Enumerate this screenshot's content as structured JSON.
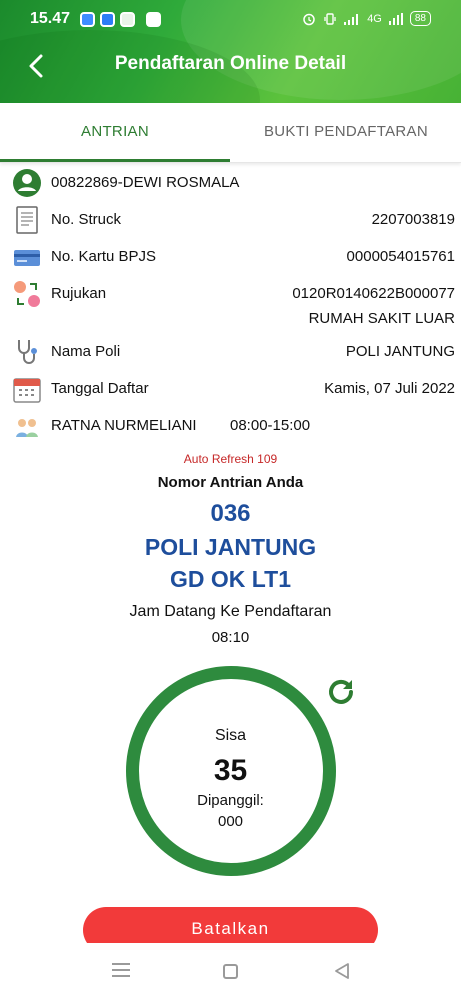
{
  "status_bar": {
    "time": "15.47",
    "network": "4G",
    "battery": "88"
  },
  "header": {
    "title": "Pendaftaran Online Detail"
  },
  "tabs": [
    {
      "label": "ANTRIAN",
      "active": true
    },
    {
      "label": "BUKTI PENDAFTARAN",
      "active": false
    }
  ],
  "patient": {
    "name": "00822869-DEWI ROSMALA"
  },
  "struck": {
    "label": "No. Struck",
    "value": "2207003819"
  },
  "bpjs": {
    "label": "No. Kartu BPJS",
    "value": "0000054015761"
  },
  "rujukan": {
    "label": "Rujukan",
    "value": "0120R0140622B000077",
    "sub": "RUMAH SAKIT LUAR"
  },
  "poli": {
    "label": "Nama Poli",
    "value": "POLI JANTUNG"
  },
  "tanggal": {
    "label": "Tanggal Daftar",
    "value": "Kamis, 07 Juli 2022"
  },
  "doctor": {
    "name": "RATNA NURMELIANI",
    "hours": "08:00-15:00"
  },
  "queue": {
    "auto_refresh": "Auto Refresh 109",
    "label": "Nomor Antrian Anda",
    "number": "036",
    "poli": "POLI JANTUNG",
    "location": "GD OK LT1",
    "jam_label": "Jam Datang Ke Pendaftaran",
    "jam_value": "08:10",
    "sisa_label": "Sisa",
    "sisa_value": "35",
    "dipanggil_label": "Dipanggil:",
    "dipanggil_value": "000"
  },
  "actions": {
    "cancel_label": "Batalkan"
  },
  "colors": {
    "primary_green": "#2e7d32",
    "queue_blue": "#1e4e9c",
    "cancel_red": "#f23a3a",
    "refresh_red": "#c62828"
  },
  "icons": [
    "back-arrow-icon",
    "user-icon",
    "receipt-icon",
    "card-icon",
    "referral-icon",
    "stethoscope-icon",
    "calendar-icon",
    "doctor-icon",
    "refresh-icon"
  ]
}
